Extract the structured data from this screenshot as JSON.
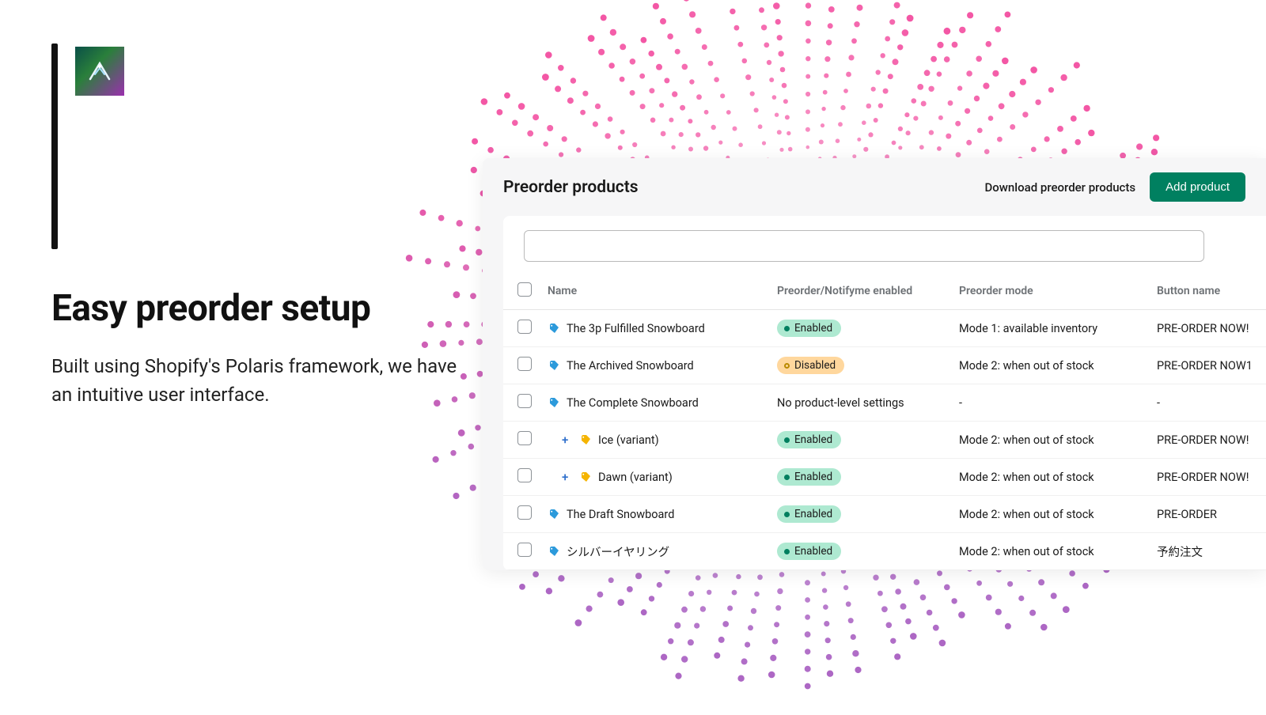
{
  "marketing": {
    "heading": "Easy preorder setup",
    "subheading": "Built using Shopify's Polaris framework, we have an intuitive user interface."
  },
  "panel": {
    "title": "Preorder products",
    "download_label": "Download preorder products",
    "add_label": "Add product",
    "search_placeholder": ""
  },
  "columns": {
    "name": "Name",
    "status": "Preorder/Notifyme enabled",
    "mode": "Preorder mode",
    "button": "Button name"
  },
  "status_labels": {
    "enabled": "Enabled",
    "disabled": "Disabled",
    "none": "No product-level settings"
  },
  "rows": [
    {
      "name": "The 3p Fulfilled Snowboard",
      "variant": false,
      "icon": "tag-blue",
      "status": "enabled",
      "mode": "Mode 1: available inventory",
      "button": "PRE-ORDER NOW!"
    },
    {
      "name": "The Archived Snowboard",
      "variant": false,
      "icon": "tag-blue",
      "status": "disabled",
      "mode": "Mode 2: when out of stock",
      "button": "PRE-ORDER NOW1"
    },
    {
      "name": "The Complete Snowboard",
      "variant": false,
      "icon": "tag-blue",
      "status": "none",
      "mode": "-",
      "button": "-"
    },
    {
      "name": "Ice (variant)",
      "variant": true,
      "icon": "tag-yellow",
      "status": "enabled",
      "mode": "Mode 2: when out of stock",
      "button": "PRE-ORDER NOW!"
    },
    {
      "name": "Dawn (variant)",
      "variant": true,
      "icon": "tag-yellow",
      "status": "enabled",
      "mode": "Mode 2: when out of stock",
      "button": "PRE-ORDER NOW!"
    },
    {
      "name": "The Draft Snowboard",
      "variant": false,
      "icon": "tag-blue",
      "status": "enabled",
      "mode": "Mode 2: when out of stock",
      "button": "PRE-ORDER"
    },
    {
      "name": "シルバーイヤリング",
      "variant": false,
      "icon": "tag-blue",
      "status": "enabled",
      "mode": "Mode 2: when out of stock",
      "button": "予約注文"
    }
  ],
  "colors": {
    "primary": "#008060",
    "badge_enabled_bg": "#aee9d1",
    "badge_disabled_bg": "#ffd79d"
  }
}
